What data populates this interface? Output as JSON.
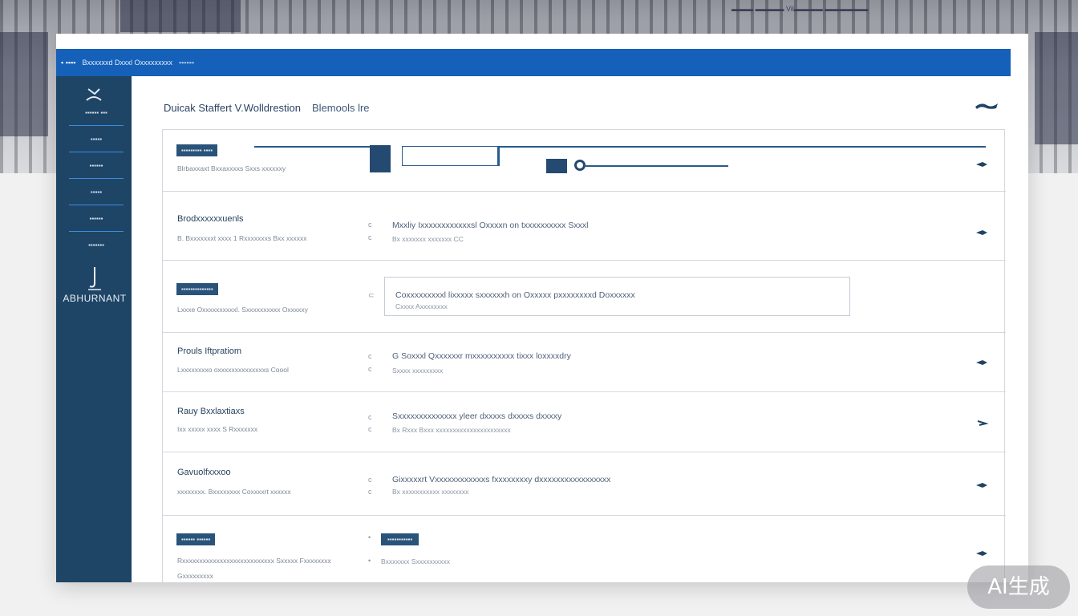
{
  "background": {
    "photo_text": "▬▬▬ ▬▬▬▬ Vil▬▬▬▬ ▬▬▬▬▬▬"
  },
  "topbar": {
    "left": "▪ ▪▪▪▪",
    "title": "Bxxxxxxd Dxxxl Oxxxxxxxxx",
    "dim": "▪▪▪▪▪▪"
  },
  "sidebar": {
    "items": [
      "▪▪▪▪▪▪ ▪▪▪",
      "▪▪▪▪▪",
      "▪▪▪▪▪▪",
      "▪▪▪▪▪",
      "▪▪▪▪▪▪",
      "▪▪▪▪▪▪▪"
    ],
    "brand": "ABHURNANT"
  },
  "header": {
    "title": "Duicak Staffert V.Wolldrestion",
    "subtitle": "Blemools lre"
  },
  "rows": [
    {
      "chip": "▪▪▪▪▪▪▪▪▪ ▪▪▪▪",
      "desc": "Blrbaxxaxt Bxxaxxxxs Sxxs xxxxxxy"
    },
    {
      "title": "Brodxxxxxxuenls",
      "desc": "B. Bxxxxxxxt xxxx 1 Rxxxxxxxs Bxx xxxxxx",
      "main": "Mxxliy Ixxxxxxxxxxxxsl Oxxxxn on txxxxxxxxxx Sxxxl",
      "sub": "Bx xxxxxxx xxxxxxx CC"
    },
    {
      "chip": "▪▪▪▪▪▪▪▪▪▪▪▪▪▪",
      "desc": "Lxxxe Oxxxxxxxxxxl. Sxxxxxxxxxx Oxxxxxy",
      "main": "Coxxxxxxxxxl lixxxxx sxxxxxxh on Oxxxxx pxxxxxxxxd Doxxxxxx",
      "sub": "Cxxxx Axxxxxxxx"
    },
    {
      "title": "Prouls Iftpratiom",
      "desc": "Lxxxxxxxxo oxxxxxxxxxxxxxxs Coool",
      "main": "G Soxxxl Qxxxxxxr mxxxxxxxxxx tixxx loxxxxdry",
      "sub": "Sxxxx xxxxxxxxx"
    },
    {
      "title": "Rauy Bxxlaxtiaxs",
      "desc": "Ixx xxxxx xxxx S Rxxxxxxx",
      "main": "Sxxxxxxxxxxxxxx yleer dxxxxs dxxxxs dxxxxy",
      "sub": "Bx Rxxx Bxxx xxxxxxxxxxxxxxxxxxxxxx"
    },
    {
      "title": "Gavuolfxxxoo",
      "desc": "xxxxxxxx. Bxxxxxxxx Coxxxxrt xxxxxx",
      "main": "Gixxxxxrt Vxxxxxxxxxxxxs fxxxxxxxxy dxxxxxxxxxxxxxxxxx",
      "sub": "Bx xxxxxxxxxxx xxxxxxxx"
    },
    {
      "chip": "▪▪▪▪▪▪ ▪▪▪▪▪▪",
      "mini_chip": "▪▪▪▪▪▪▪▪▪▪▪",
      "desc": "Rxxxxxxxxxxxxxxxxxxxxxxxxxxx Sxxxxx Fxxxxxxxx",
      "desc2": "Gxxxxxxxxx",
      "sub": "Bxxxxxxx Sxxxxxxxxxx"
    }
  ],
  "watermark": "AI生成"
}
